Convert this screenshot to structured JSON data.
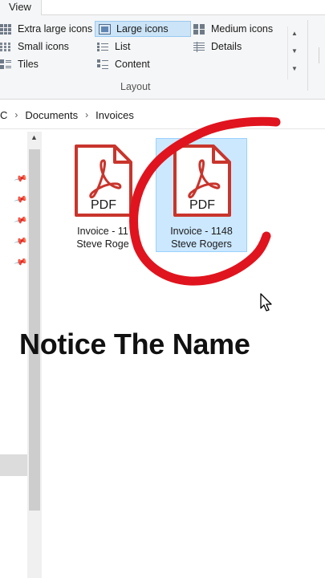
{
  "ribbon": {
    "tab_view": "View",
    "layout_options": {
      "extra_large_icons": "Extra large icons",
      "large_icons": "Large icons",
      "medium_icons": "Medium icons",
      "small_icons": "Small icons",
      "list": "List",
      "details": "Details",
      "tiles": "Tiles",
      "content": "Content"
    },
    "selected_layout": "Large icons",
    "group_label": "Layout"
  },
  "address_bar": {
    "crumbs": [
      "C",
      "Documents",
      "Invoices"
    ]
  },
  "files": [
    {
      "icon_text": "PDF",
      "name_line1": "Invoice - 11",
      "name_line2": "Steve Roge",
      "selected": false
    },
    {
      "icon_text": "PDF",
      "name_line1": "Invoice - 1148",
      "name_line2": "Steve Rogers",
      "selected": true
    }
  ],
  "caption": "Notice The Name",
  "colors": {
    "pdf_red": "#c8352c",
    "selection": "#cce8ff",
    "annotation": "#e0141e"
  },
  "icons": {
    "pin": "pin-icon",
    "pdf": "pdf-file-icon",
    "cursor": "mouse-pointer-icon"
  }
}
